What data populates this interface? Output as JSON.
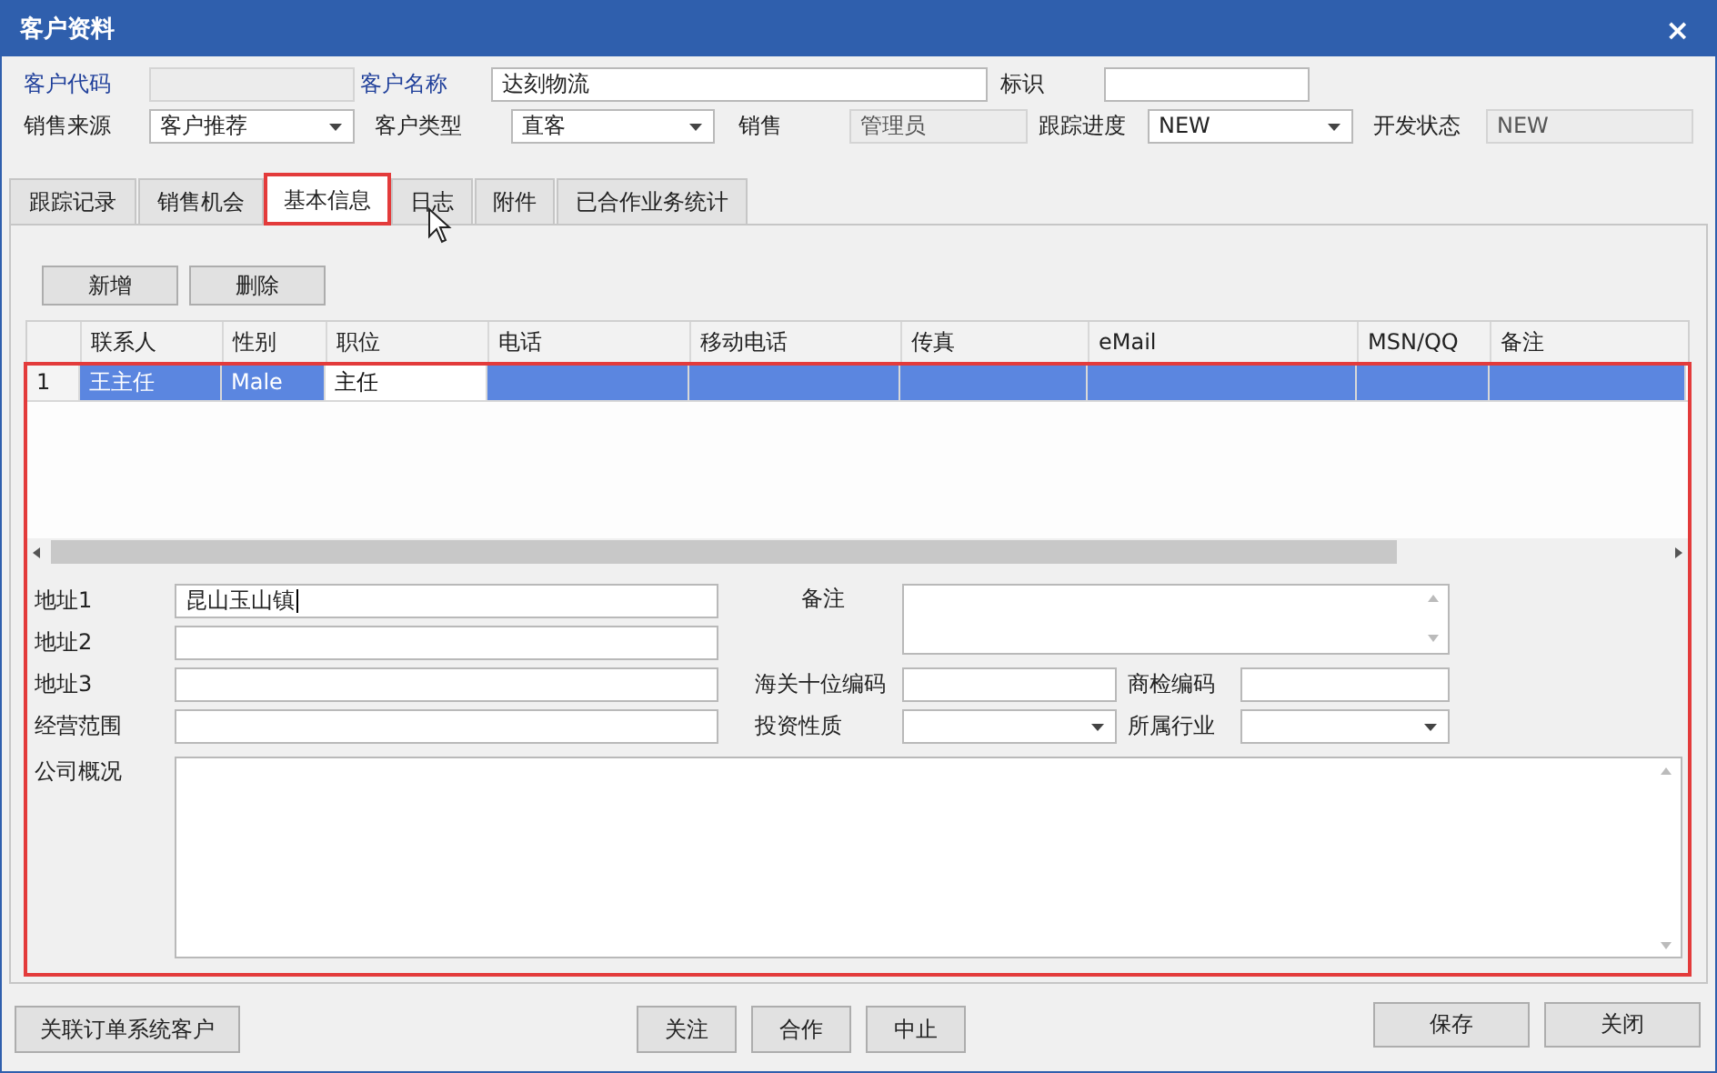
{
  "window": {
    "title": "客户资料",
    "close": "×"
  },
  "header_rows": [
    [
      {
        "label": "客户代码",
        "required": true,
        "kind": "readonly"
      },
      {
        "label": "客户名称",
        "required": true,
        "kind": "text",
        "value": "达刻物流"
      },
      {
        "label": "标识",
        "required": false,
        "kind": "text"
      }
    ],
    [
      {
        "label": "销售来源",
        "required": false,
        "kind": "combo",
        "value": "客户推荐"
      },
      {
        "label": "客户类型",
        "required": false,
        "kind": "combo",
        "value": "直客"
      },
      {
        "label": "销售",
        "required": false,
        "kind": "readonly",
        "value": "管理员"
      },
      {
        "label": "跟踪进度",
        "required": false,
        "kind": "combo",
        "value": "NEW"
      },
      {
        "label": "开发状态",
        "required": false,
        "kind": "readonly",
        "value": "NEW"
      }
    ]
  ],
  "tabs": [
    {
      "label": "跟踪记录",
      "selected": false,
      "highlighted": false
    },
    {
      "label": "销售机会",
      "selected": false,
      "highlighted": false
    },
    {
      "label": "基本信息",
      "selected": true,
      "highlighted": true
    },
    {
      "label": "日志",
      "selected": false,
      "highlighted": false
    },
    {
      "label": "附件",
      "selected": false,
      "highlighted": false
    },
    {
      "label": "已合作业务统计",
      "selected": false,
      "highlighted": false
    }
  ],
  "toolbar": [
    "新增",
    "删除"
  ],
  "contacts": {
    "columns": [
      "联系人",
      "性别",
      "职位",
      "电话",
      "移动电话",
      "传真",
      "eMail",
      "MSN/QQ",
      "备注"
    ],
    "rows": [
      {
        "number": "1",
        "selected": true,
        "cells": [
          {
            "text": "王主任",
            "focused": false
          },
          {
            "text": "Male",
            "focused": false
          },
          {
            "text": "主任",
            "focused": true
          },
          {
            "focused": false
          },
          {
            "focused": false
          },
          {
            "focused": false
          },
          {
            "focused": false
          },
          {
            "focused": false
          },
          {
            "focused": false
          }
        ]
      }
    ]
  },
  "form": {
    "highlighted": true,
    "left": [
      {
        "label": "地址1",
        "value": "昆山玉山镇",
        "focused": true
      },
      {
        "label": "地址2",
        "focused": false
      },
      {
        "label": "地址3",
        "focused": false
      },
      {
        "label": "经营范围",
        "focused": false
      }
    ],
    "remark": {
      "label": "备注"
    },
    "right_rows": [
      [
        {
          "label": "海关十位编码",
          "kind": "text"
        },
        {
          "label": "商检编码",
          "kind": "text"
        }
      ],
      [
        {
          "label": "投资性质",
          "kind": "combo"
        },
        {
          "label": "所属行业",
          "kind": "combo"
        }
      ]
    ],
    "overview": {
      "label": "公司概况"
    }
  },
  "footer": {
    "left": [
      "关联订单系统客户"
    ],
    "center": [
      "关注",
      "合作",
      "中止"
    ],
    "right": [
      "保存",
      "关闭"
    ]
  }
}
